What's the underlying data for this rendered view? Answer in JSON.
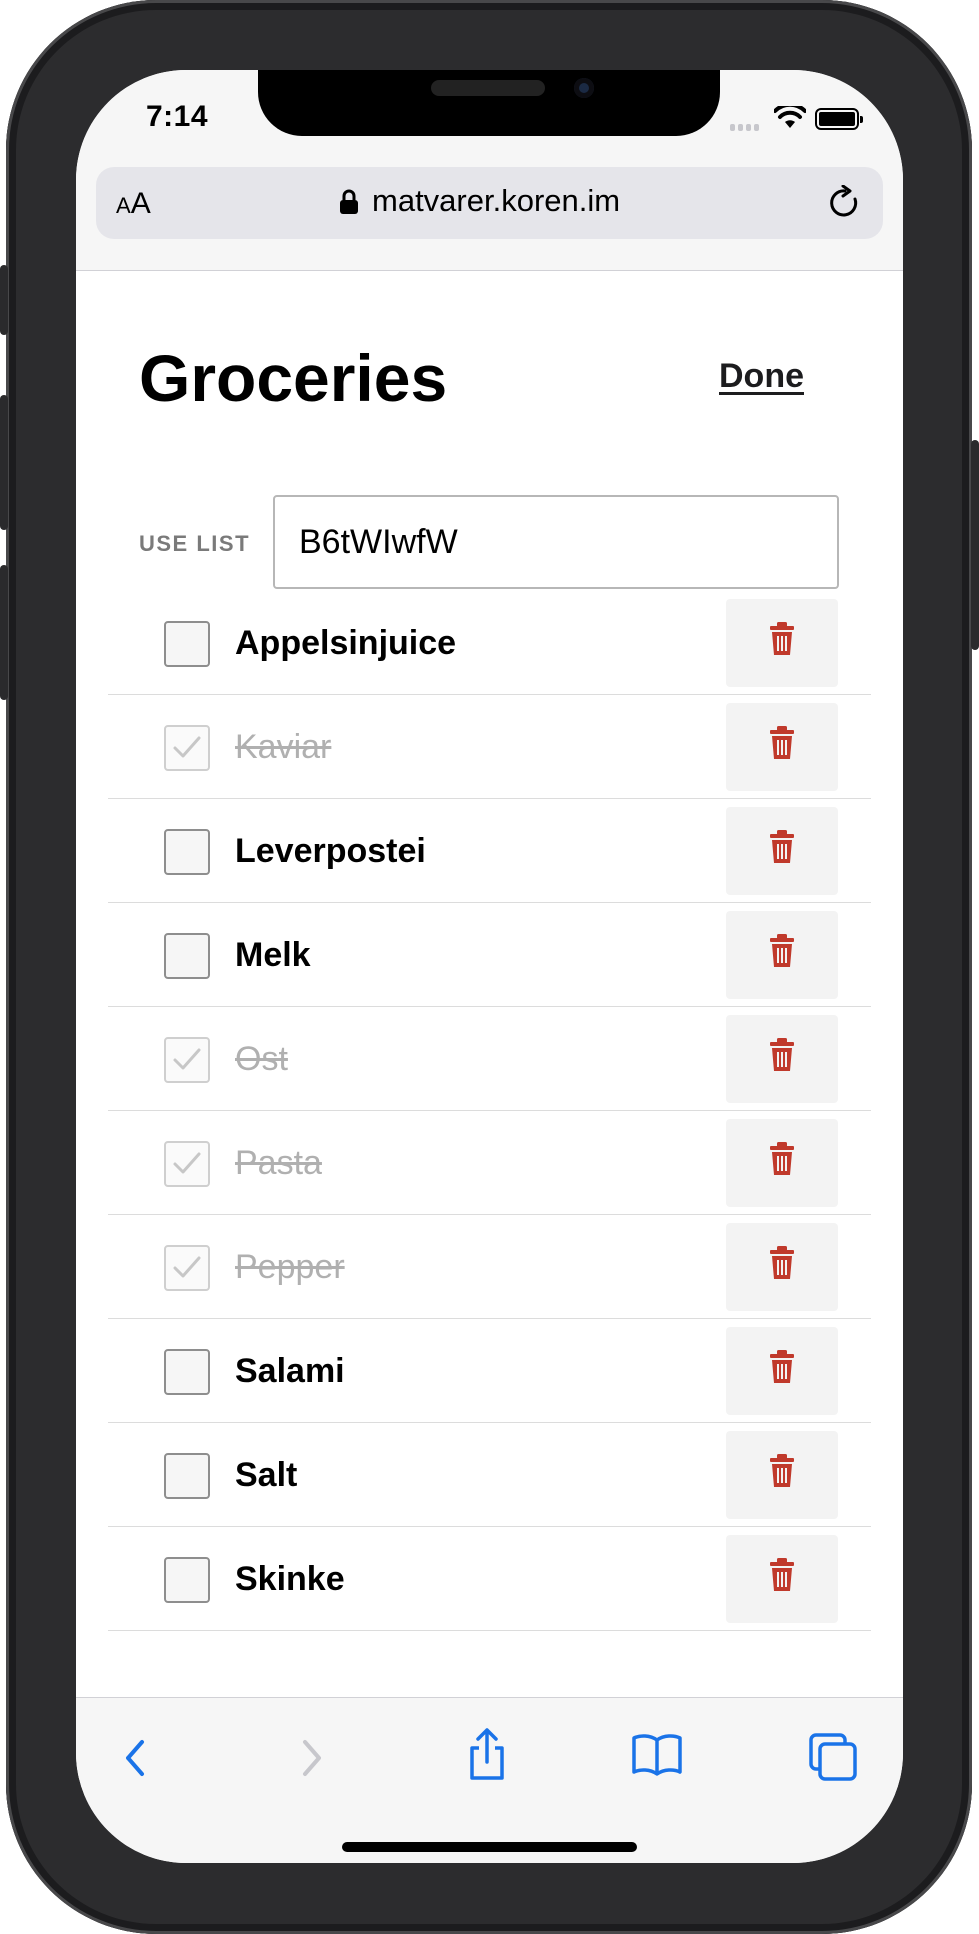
{
  "status_bar": {
    "time": "7:14"
  },
  "browser": {
    "reader_label_small": "A",
    "reader_label_large": "A",
    "url": "matvarer.koren.im"
  },
  "page": {
    "title": "Groceries",
    "done_label": "Done",
    "use_list_label": "USE LIST",
    "list_code": "B6tWIwfW"
  },
  "items": [
    {
      "name": "Appelsinjuice",
      "checked": false
    },
    {
      "name": "Kaviar",
      "checked": true
    },
    {
      "name": "Leverpostei",
      "checked": false
    },
    {
      "name": "Melk",
      "checked": false
    },
    {
      "name": "Ost",
      "checked": true
    },
    {
      "name": "Pasta",
      "checked": true
    },
    {
      "name": "Pepper",
      "checked": true
    },
    {
      "name": "Salami",
      "checked": false
    },
    {
      "name": "Salt",
      "checked": false
    },
    {
      "name": "Skinke",
      "checked": false
    }
  ],
  "colors": {
    "delete_icon": "#c0392b",
    "toolbar_active": "#1a73e8",
    "toolbar_disabled": "#c7c7cc"
  },
  "toolbar": {
    "icons": [
      "back-icon",
      "forward-icon",
      "share-icon",
      "bookmarks-icon",
      "tabs-icon"
    ]
  }
}
